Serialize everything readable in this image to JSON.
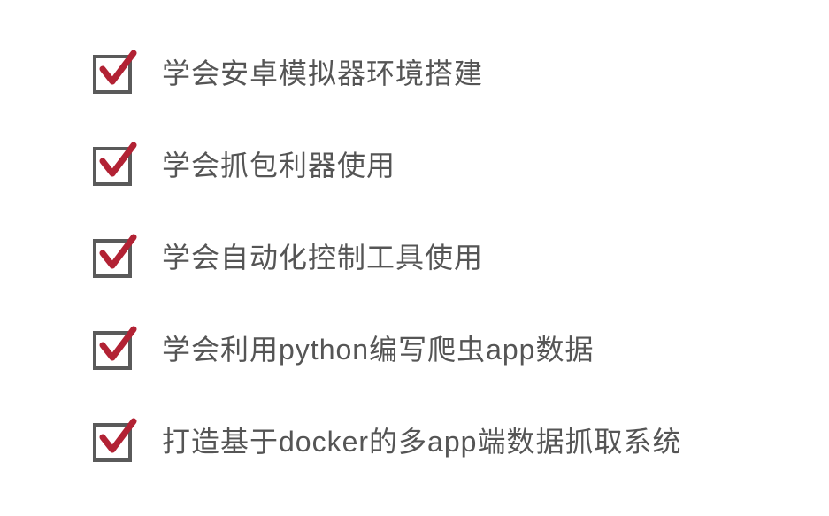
{
  "list": {
    "items": [
      {
        "label": "学会安卓模拟器环境搭建"
      },
      {
        "label": "学会抓包利器使用"
      },
      {
        "label": "学会自动化控制工具使用"
      },
      {
        "label": "学会利用python编写爬虫app数据"
      },
      {
        "label": "打造基于docker的多app端数据抓取系统"
      }
    ]
  },
  "colors": {
    "checkmark": "#b22234",
    "box_border": "#5a5a5a",
    "text": "#555555"
  }
}
